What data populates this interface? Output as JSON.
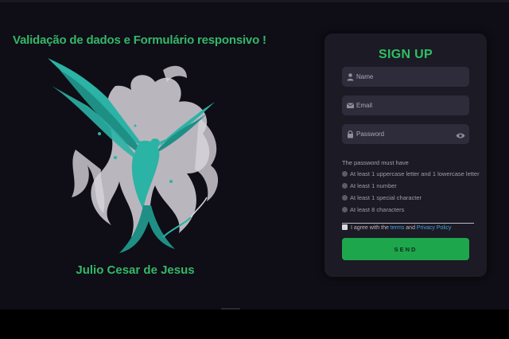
{
  "page": {
    "headline": "Validação de dados e Formulário responsivo !",
    "author": "Julio Cesar de Jesus"
  },
  "form": {
    "title": "SIGN UP",
    "fields": [
      {
        "icon": "user-icon",
        "placeholder": "Name"
      },
      {
        "icon": "mail-icon",
        "placeholder": "Email"
      },
      {
        "icon": "lock-icon",
        "placeholder": "Password"
      }
    ],
    "password_rules_title": "The password must have",
    "password_rules": [
      "At least 1 uppercase letter and 1 lowercase letter",
      "At least 1 number",
      "At least 1 special character",
      "At least 8 characters"
    ],
    "agree": {
      "prefix": "I agree with the",
      "terms_link": "terms",
      "and": "and",
      "privacy_link": "Privacy Policy"
    },
    "send_label": "SEND"
  },
  "colors": {
    "background": "#0f0d15",
    "card": "#1b1a25",
    "accent_green": "#2fbf63",
    "link_blue": "#3ea3d8",
    "phoenix_teal": "#2bb3a5",
    "phoenix_flame": "#d8d5dc"
  }
}
